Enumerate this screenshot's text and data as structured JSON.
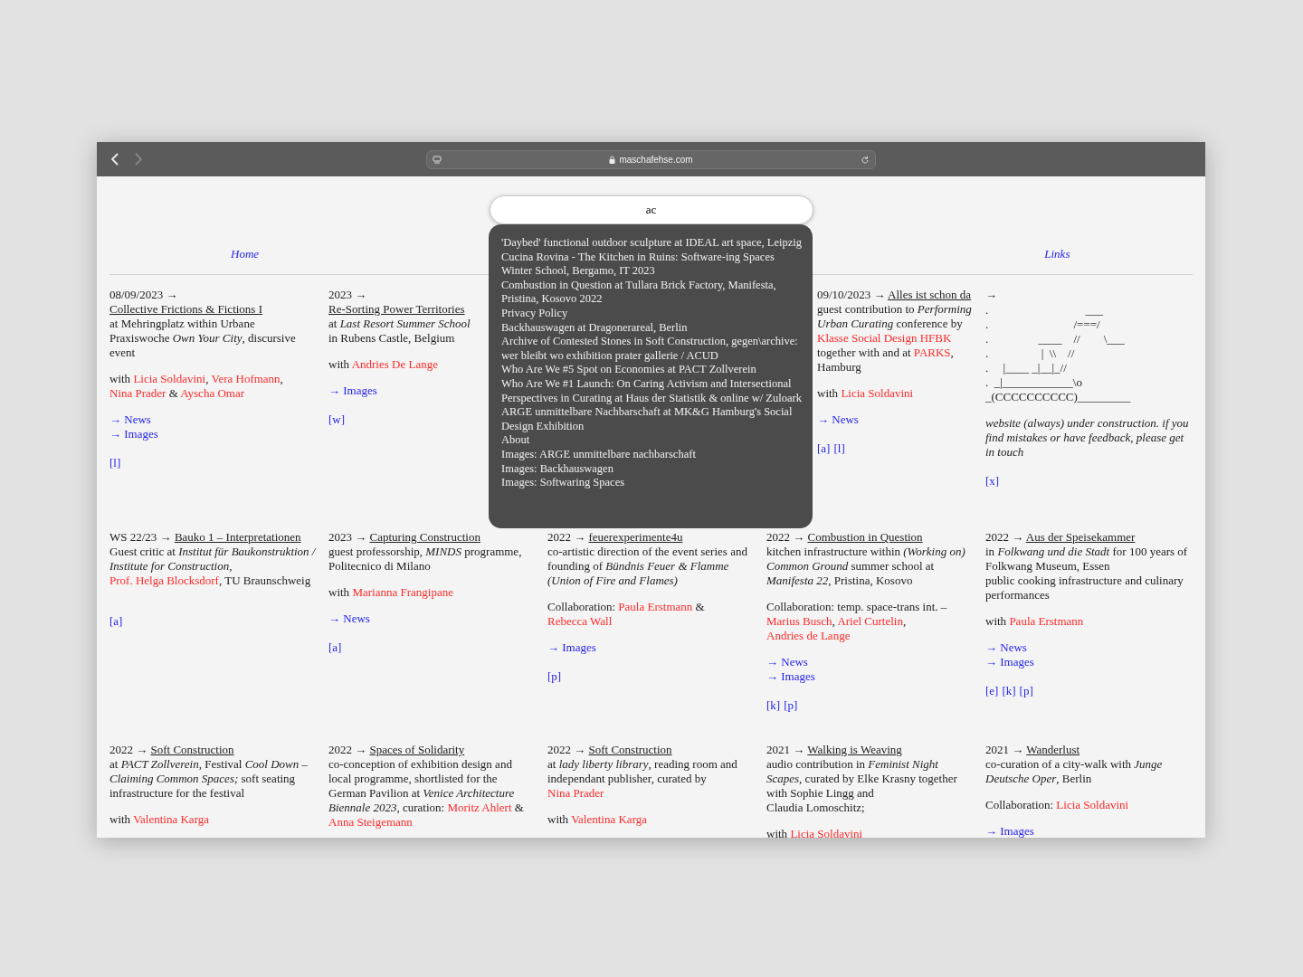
{
  "browser": {
    "url": "maschafehse.com"
  },
  "search": {
    "value": "ac",
    "results": [
      "'Daybed' functional outdoor sculpture at IDEAL art space, Leipzig",
      "Cucina Rovina - The Kitchen in Ruins: Software-ing Spaces Winter School, Bergamo, IT 2023",
      "Combustion in Question at Tullara Brick Factory, Manifesta, Pristina, Kosovo 2022",
      "Privacy Policy",
      "Backhauswagen at Dragonerareal, Berlin",
      "Archive of Contested Stones in Soft Construction, gegen\\archive: wer bleibt wo exhibition prater gallerie / ACUD",
      "Who Are We #5 Spot on Economies at PACT Zollverein",
      "Who Are We #1 Launch: On Caring Activism and Intersectional Perspectives in Curating at Haus der Statistik & online w/ Zuloark",
      "ARGE unmittelbare Nachbarschaft at MK&G Hamburg's Social Design Exhibition",
      "About",
      "Images: ARGE unmittelbare nachbarschaft",
      "Images: Backhauswagen",
      "Images: Softwaring Spaces"
    ]
  },
  "nav": [
    {
      "label": "Home"
    },
    {
      "label": "Links"
    }
  ],
  "entries": [
    {
      "date": "08/09/2023 →",
      "title": "Collective Frictions & Fictions I",
      "blocks": [
        {
          "kind": "text",
          "lines": [
            [
              {
                "kind": "plain",
                "text": "at Mehringplatz within Urbane Praxiswoche *Own Your City*, discursive event"
              }
            ]
          ]
        },
        {
          "kind": "text",
          "lines": [
            [
              {
                "kind": "plain",
                "text": "with "
              },
              {
                "kind": "person",
                "text": "Licia Soldavini"
              },
              {
                "kind": "plain",
                "text": ", "
              },
              {
                "kind": "person",
                "text": "Vera Hofmann"
              },
              {
                "kind": "plain",
                "text": ", "
              },
              {
                "kind": "person",
                "text": "Nina Prader"
              },
              {
                "kind": "plain",
                "text": " & "
              },
              {
                "kind": "person",
                "text": "Ayscha Omar"
              }
            ]
          ]
        },
        {
          "kind": "links",
          "items": [
            "→ News",
            "→ Images"
          ]
        },
        {
          "kind": "refs",
          "items": [
            "[l]"
          ]
        }
      ]
    },
    {
      "date": "2023 →",
      "title": "Re-Sorting Power Territories",
      "blocks": [
        {
          "kind": "text",
          "lines": [
            [
              {
                "kind": "plain",
                "text": "at *Last Resort Summer School* in Rubens Castle, Belgium"
              }
            ]
          ]
        },
        {
          "kind": "text",
          "lines": [
            [
              {
                "kind": "plain",
                "text": "with "
              },
              {
                "kind": "person",
                "text": "Andries De Lange"
              }
            ]
          ]
        },
        {
          "kind": "links",
          "items": [
            "→ Images"
          ]
        },
        {
          "kind": "refs",
          "items": [
            "[w]"
          ]
        }
      ]
    },
    {
      "date": "09/10/2023 →",
      "title": "Alles ist schon da",
      "blocks": [
        {
          "kind": "text",
          "lines": [
            [
              {
                "kind": "plain",
                "text": "guest contribution to *Performing Urban Curating* conference by "
              },
              {
                "kind": "person",
                "text": "Klasse Social Design HFBK"
              },
              {
                "kind": "plain",
                "text": " together with and at "
              },
              {
                "kind": "person",
                "text": "PARKS"
              },
              {
                "kind": "plain",
                "text": ", Hamburg"
              }
            ]
          ]
        },
        {
          "kind": "text",
          "lines": [
            [
              {
                "kind": "plain",
                "text": "with "
              },
              {
                "kind": "person",
                "text": "Licia Soldavini"
              }
            ]
          ]
        },
        {
          "kind": "links",
          "items": [
            "→ News"
          ]
        },
        {
          "kind": "refs",
          "items": [
            "[a]",
            "[l]"
          ]
        }
      ]
    },
    {
      "date": "→",
      "blocks": [
        {
          "kind": "art",
          "text": ".                                 ___\n.                             /===/\n.                 ____    //        \\___\n.                  |  \\\\    //\n.     |____ _|__|_//\n.  _|____________\\o\n_(CCCCCCCCCC)_________"
        },
        {
          "kind": "note",
          "text": "website (always) under construction. if you find mistakes or have feedback, please get in touch"
        },
        {
          "kind": "refs",
          "items": [
            "[x]"
          ]
        }
      ]
    },
    {
      "date": "WS 22/23 →",
      "title": "Bauko 1 – Interpretationen",
      "blocks": [
        {
          "kind": "text",
          "lines": [
            [
              {
                "kind": "plain",
                "text": "Guest critic at *Institut für Baukonstruktion / Institute for Construction*, "
              },
              {
                "kind": "person",
                "text": "Prof. Helga Blocksdorf"
              },
              {
                "kind": "plain",
                "text": ", TU Braunschweig"
              }
            ]
          ]
        },
        {
          "kind": "refs",
          "items": [
            "[a]"
          ]
        }
      ]
    },
    {
      "date": "2023 →",
      "title": "Capturing Construction",
      "blocks": [
        {
          "kind": "text",
          "lines": [
            [
              {
                "kind": "plain",
                "text": "guest professorship, *MINDS* programme, Politecnico di Milano"
              }
            ]
          ]
        },
        {
          "kind": "text",
          "lines": [
            [
              {
                "kind": "plain",
                "text": "with "
              },
              {
                "kind": "person",
                "text": "Marianna Frangipane"
              }
            ]
          ]
        },
        {
          "kind": "links",
          "items": [
            "→ News"
          ]
        },
        {
          "kind": "refs",
          "items": [
            "[a]"
          ]
        }
      ]
    },
    {
      "date": "2022 →",
      "title": "feuerexperimente4u",
      "blocks": [
        {
          "kind": "text",
          "lines": [
            [
              {
                "kind": "plain",
                "text": "co-artistic direction of the event series and founding of *Bündnis Feuer & Flamme (Union of Fire and Flames)*"
              }
            ]
          ]
        },
        {
          "kind": "text",
          "lines": [
            [
              {
                "kind": "plain",
                "text": "Collaboration: "
              },
              {
                "kind": "person",
                "text": "Paula Erstmann"
              },
              {
                "kind": "plain",
                "text": " & "
              },
              {
                "kind": "person",
                "text": "Rebecca Wall"
              }
            ]
          ]
        },
        {
          "kind": "links",
          "items": [
            "→ Images"
          ]
        },
        {
          "kind": "refs",
          "items": [
            "[p]"
          ]
        }
      ]
    },
    {
      "date": "2022 →",
      "title": "Combustion in Question",
      "blocks": [
        {
          "kind": "text",
          "lines": [
            [
              {
                "kind": "plain",
                "text": "kitchen infrastructure within *(Working on) Common Ground* summer school at *Manifesta 22*, Pristina, Kosovo"
              }
            ]
          ]
        },
        {
          "kind": "text",
          "lines": [
            [
              {
                "kind": "plain",
                "text": "Collaboration: temp. space-trans int. – "
              },
              {
                "kind": "person",
                "text": "Marius Busch"
              },
              {
                "kind": "plain",
                "text": ", "
              },
              {
                "kind": "person",
                "text": "Ariel Curtelin"
              },
              {
                "kind": "plain",
                "text": ", "
              },
              {
                "kind": "person",
                "text": "Andries de Lange"
              }
            ]
          ]
        },
        {
          "kind": "links",
          "items": [
            "→ News",
            "→ Images"
          ]
        },
        {
          "kind": "refs",
          "items": [
            "[k]",
            "[p]"
          ]
        }
      ]
    },
    {
      "date": "2022 →",
      "title": "Aus der Speisekammer",
      "blocks": [
        {
          "kind": "text",
          "lines": [
            [
              {
                "kind": "plain",
                "text": "in  *Folkwang und die Stadt* for 100 years of Folkwang Museum, Essen"
              }
            ],
            [
              {
                "kind": "plain",
                "text": "public cooking infrastructure and culinary performances"
              }
            ]
          ]
        },
        {
          "kind": "text",
          "lines": [
            [
              {
                "kind": "plain",
                "text": "with "
              },
              {
                "kind": "person",
                "text": "Paula Erstmann"
              }
            ]
          ]
        },
        {
          "kind": "links",
          "items": [
            "→ News",
            "→ Images"
          ]
        },
        {
          "kind": "refs",
          "items": [
            "[e]",
            "[k]",
            "[p]"
          ]
        }
      ]
    },
    {
      "date": "2022 →",
      "title": "Soft Construction",
      "blocks": [
        {
          "kind": "text",
          "lines": [
            [
              {
                "kind": "plain",
                "text": "at *PACT Zollverein*, Festival *Cool Down – Claiming Common Spaces;* soft seating infrastructure for the festival"
              }
            ]
          ]
        },
        {
          "kind": "text",
          "lines": [
            [
              {
                "kind": "plain",
                "text": "with "
              },
              {
                "kind": "person",
                "text": "Valentina Karga"
              }
            ]
          ]
        }
      ]
    },
    {
      "date": "2022 →",
      "title": "Spaces of Solidarity",
      "blocks": [
        {
          "kind": "text",
          "lines": [
            [
              {
                "kind": "plain",
                "text": "co-conception of exhibition design and local programme, shortlisted for the German Pavilion at *Venice Architecture Biennale 2023*, curation: "
              },
              {
                "kind": "person",
                "text": "Moritz Ahlert"
              },
              {
                "kind": "plain",
                "text": " & "
              },
              {
                "kind": "person",
                "text": "Anna Steigemann"
              }
            ]
          ]
        }
      ]
    },
    {
      "date": "2022 →",
      "title": "Soft Construction",
      "blocks": [
        {
          "kind": "text",
          "lines": [
            [
              {
                "kind": "plain",
                "text": "at *lady liberty library*, reading room and independant publisher, curated by "
              },
              {
                "kind": "person",
                "text": "Nina Prader"
              }
            ]
          ]
        },
        {
          "kind": "text",
          "lines": [
            [
              {
                "kind": "plain",
                "text": "with "
              },
              {
                "kind": "person",
                "text": "Valentina Karga"
              }
            ]
          ]
        }
      ]
    },
    {
      "date": "2021 →",
      "title": "Walking is Weaving",
      "blocks": [
        {
          "kind": "text",
          "lines": [
            [
              {
                "kind": "plain",
                "text": "audio contribution in *Feminist Night Scapes*, curated by Elke Krasny together with Sophie Lingg and"
              }
            ],
            [
              {
                "kind": "plain",
                "text": "Claudia Lomoschitz;"
              }
            ]
          ]
        },
        {
          "kind": "text",
          "lines": [
            [
              {
                "kind": "plain",
                "text": "with "
              },
              {
                "kind": "person",
                "text": "Licia Soldavini"
              }
            ]
          ]
        }
      ]
    },
    {
      "date": "2021 →",
      "title": "Wanderlust",
      "blocks": [
        {
          "kind": "text",
          "lines": [
            [
              {
                "kind": "plain",
                "text": "co-curation of a city-walk with *Junge Deutsche Oper*, Berlin"
              }
            ]
          ]
        },
        {
          "kind": "text",
          "lines": [
            [
              {
                "kind": "plain",
                "text": "Collaboration: "
              },
              {
                "kind": "person",
                "text": "Licia Soldavini"
              }
            ]
          ]
        },
        {
          "kind": "links",
          "items": [
            "→ Images"
          ]
        }
      ]
    }
  ]
}
